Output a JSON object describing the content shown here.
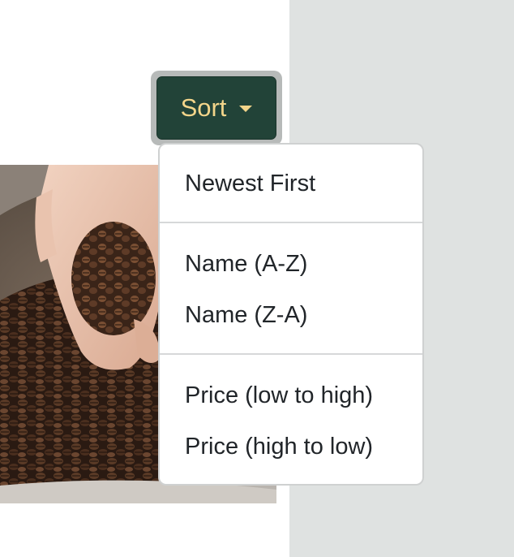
{
  "sort": {
    "label": "Sort",
    "caret_icon": "caret-down-icon"
  },
  "dropdown": {
    "groups": [
      {
        "items": [
          "Newest First"
        ]
      },
      {
        "items": [
          "Name (A-Z)",
          "Name (Z-A)"
        ]
      },
      {
        "items": [
          "Price (low to high)",
          "Price (high to low)"
        ]
      }
    ]
  },
  "colors": {
    "button_bg": "#224338",
    "button_text": "#f3d58a",
    "panel_bg": "#dfe2e1",
    "menu_border": "#cfd1d1",
    "menu_text": "#212529"
  }
}
